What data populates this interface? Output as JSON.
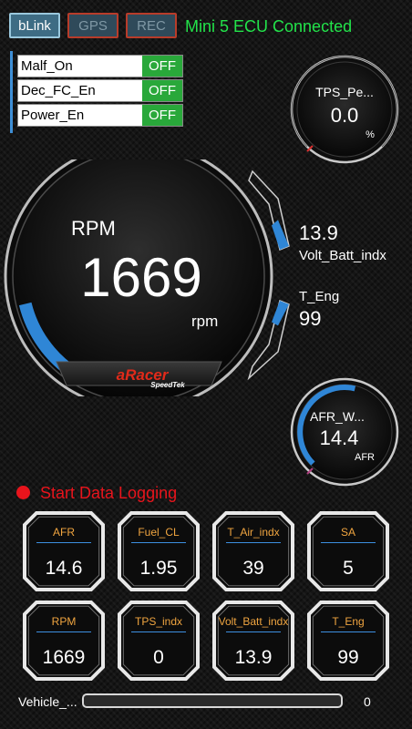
{
  "topbar": {
    "blink_label": "bLink",
    "gps_label": "GPS",
    "rec_label": "REC",
    "status": "Mini 5 ECU Connected"
  },
  "switches": [
    {
      "label": "Malf_On",
      "value": "OFF"
    },
    {
      "label": "Dec_FC_En",
      "value": "OFF"
    },
    {
      "label": "Power_En",
      "value": "OFF"
    }
  ],
  "tps_gauge": {
    "title": "TPS_Pe...",
    "value": "0.0",
    "unit": "%",
    "fraction": 0.0
  },
  "rpm_gauge": {
    "title": "RPM",
    "value": "1669",
    "unit": "rpm",
    "fraction": 0.16,
    "brand": "aRacer",
    "brand_sub": "SpeedTek"
  },
  "volt_side": {
    "value": "13.9",
    "label": "Volt_Batt_indx",
    "fraction": 0.55
  },
  "teng_side": {
    "label": "T_Eng",
    "value": "99",
    "fraction": 0.45
  },
  "afr_gauge": {
    "title": "AFR_W...",
    "value": "14.4",
    "unit": "AFR",
    "fraction": 0.55
  },
  "logging": {
    "label": "Start Data Logging"
  },
  "tiles": [
    {
      "label": "AFR",
      "value": "14.6"
    },
    {
      "label": "Fuel_CL",
      "value": "1.95"
    },
    {
      "label": "T_Air_indx",
      "value": "39"
    },
    {
      "label": "SA",
      "value": "5"
    },
    {
      "label": "RPM",
      "value": "1669"
    },
    {
      "label": "TPS_indx",
      "value": "0"
    },
    {
      "label": "Volt_Batt_indx",
      "value": "13.9"
    },
    {
      "label": "T_Eng",
      "value": "99"
    }
  ],
  "vehicle": {
    "label": "Vehicle_...",
    "value": "0",
    "fraction": 0.0
  },
  "colors": {
    "accent_blue": "#2f86d6",
    "status_green": "#22e34a",
    "alert_red": "#e8141c",
    "tile_label": "#f0a540",
    "switch_green": "#29a83a"
  }
}
